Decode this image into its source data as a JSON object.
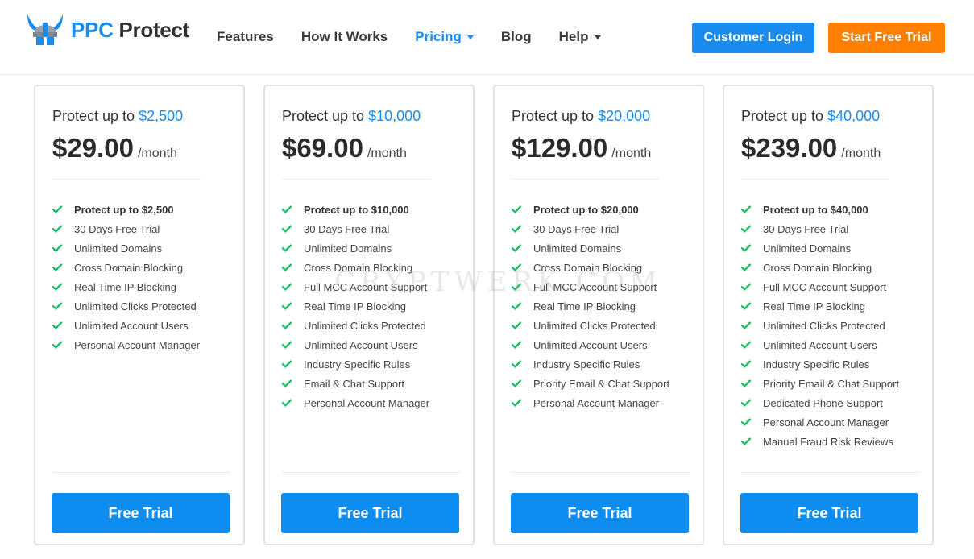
{
  "header": {
    "logo": {
      "ppc": "PPC",
      "protect": "Protect"
    },
    "nav": [
      {
        "label": "Features",
        "dropdown": false,
        "active": false
      },
      {
        "label": "How It Works",
        "dropdown": false,
        "active": false
      },
      {
        "label": "Pricing",
        "dropdown": true,
        "active": true
      },
      {
        "label": "Blog",
        "dropdown": false,
        "active": false
      },
      {
        "label": "Help",
        "dropdown": true,
        "active": false
      }
    ],
    "login_label": "Customer Login",
    "trial_label": "Start Free Trial"
  },
  "colors": {
    "accent": "#1a8cf0",
    "orange": "#ff7f00",
    "check": "#1fbf6a"
  },
  "watermark": "CRYPTWERK.COM",
  "plans": [
    {
      "head": "Protect up to ",
      "amount": "$2,500",
      "price": "$29.00",
      "per": "/month",
      "features": [
        "Protect up to $2,500",
        "30 Days Free Trial",
        "Unlimited Domains",
        "Cross Domain Blocking",
        "Real Time IP Blocking",
        "Unlimited Clicks Protected",
        "Unlimited Account Users",
        "Personal Account Manager"
      ],
      "cta": "Free Trial"
    },
    {
      "head": "Protect up to ",
      "amount": "$10,000",
      "price": "$69.00",
      "per": "/month",
      "features": [
        "Protect up to $10,000",
        "30 Days Free Trial",
        "Unlimited Domains",
        "Cross Domain Blocking",
        "Full MCC Account Support",
        "Real Time IP Blocking",
        "Unlimited Clicks Protected",
        "Unlimited Account Users",
        "Industry Specific Rules",
        "Email & Chat Support",
        "Personal Account Manager"
      ],
      "cta": "Free Trial"
    },
    {
      "head": "Protect up to ",
      "amount": "$20,000",
      "price": "$129.00",
      "per": "/month",
      "features": [
        "Protect up to $20,000",
        "30 Days Free Trial",
        "Unlimited Domains",
        "Cross Domain Blocking",
        "Full MCC Account Support",
        "Real Time IP Blocking",
        "Unlimited Clicks Protected",
        "Unlimited Account Users",
        "Industry Specific Rules",
        "Priority Email & Chat Support",
        "Personal Account Manager"
      ],
      "cta": "Free Trial"
    },
    {
      "head": "Protect up to ",
      "amount": "$40,000",
      "price": "$239.00",
      "per": "/month",
      "features": [
        "Protect up to $40,000",
        "30 Days Free Trial",
        "Unlimited Domains",
        "Cross Domain Blocking",
        "Full MCC Account Support",
        "Real Time IP Blocking",
        "Unlimited Clicks Protected",
        "Unlimited Account Users",
        "Industry Specific Rules",
        "Priority Email & Chat Support",
        "Dedicated Phone Support",
        "Personal Account Manager",
        "Manual Fraud Risk Reviews"
      ],
      "cta": "Free Trial"
    }
  ]
}
